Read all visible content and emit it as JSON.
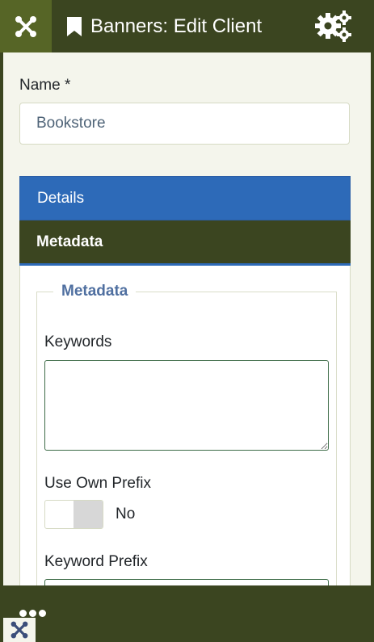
{
  "header": {
    "title": "Banners: Edit Client",
    "logo_icon": "joomla-logo-icon",
    "title_icon": "bookmark-icon",
    "options_icon": "gears-icon"
  },
  "form": {
    "name_label": "Name *",
    "name_value": "Bookstore"
  },
  "tabs": [
    {
      "label": "Details",
      "active": false
    },
    {
      "label": "Metadata",
      "active": true
    }
  ],
  "metadata": {
    "legend": "Metadata",
    "keywords_label": "Keywords",
    "keywords_value": "",
    "own_prefix_label": "Use Own Prefix",
    "own_prefix_value": "No",
    "keyword_prefix_label": "Keyword Prefix"
  },
  "footer": {
    "more_icon": "more-dots-icon",
    "corner_icon": "joomla-logo-icon"
  },
  "colors": {
    "header_bg": "#3b4520",
    "logo_bg": "#566526",
    "tab_blue": "#2d6ab8",
    "legend": "#4f6fa0"
  }
}
